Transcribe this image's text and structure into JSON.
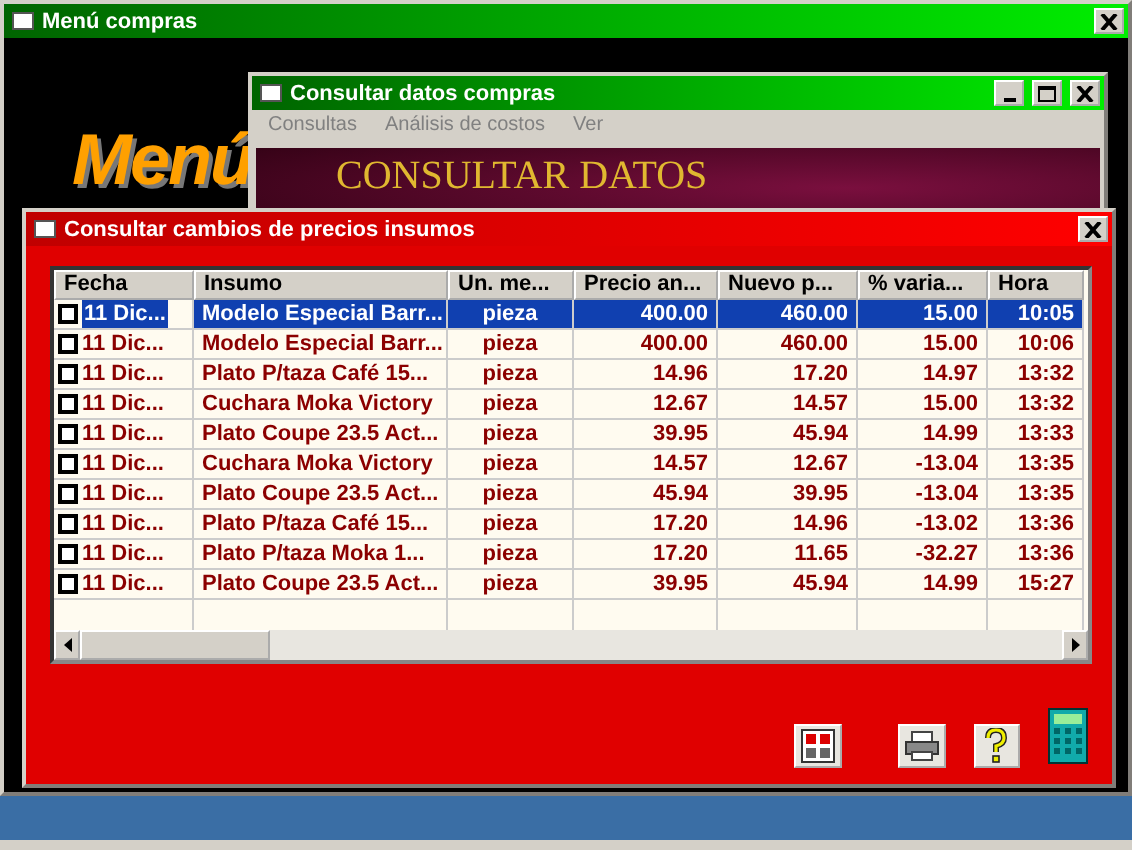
{
  "main_window": {
    "title": "Menú compras",
    "logo": "Menú"
  },
  "query_window": {
    "title": "Consultar datos compras",
    "menu": [
      "Consultas",
      "Análisis de costos",
      "Ver"
    ],
    "banner": "CONSULTAR DATOS"
  },
  "changes_window": {
    "title": "Consultar cambios de precios insumos",
    "table": {
      "columns": [
        "Fecha",
        "Insumo",
        "Un. me...",
        "Precio an...",
        "Nuevo p...",
        "% varia...",
        "Hora"
      ],
      "rows": [
        {
          "checked": false,
          "selected": true,
          "cells": [
            "11 Dic...",
            "Modelo Especial Barr...",
            "pieza",
            "400.00",
            "460.00",
            "15.00",
            "10:05"
          ]
        },
        {
          "checked": false,
          "selected": false,
          "cells": [
            "11 Dic...",
            "Modelo Especial Barr...",
            "pieza",
            "400.00",
            "460.00",
            "15.00",
            "10:06"
          ]
        },
        {
          "checked": false,
          "selected": false,
          "cells": [
            "11 Dic...",
            "Plato P/taza Café 15...",
            "pieza",
            "14.96",
            "17.20",
            "14.97",
            "13:32"
          ]
        },
        {
          "checked": false,
          "selected": false,
          "cells": [
            "11 Dic...",
            "Cuchara Moka Victory",
            "pieza",
            "12.67",
            "14.57",
            "15.00",
            "13:32"
          ]
        },
        {
          "checked": false,
          "selected": false,
          "cells": [
            "11 Dic...",
            "Plato Coupe 23.5 Act...",
            "pieza",
            "39.95",
            "45.94",
            "14.99",
            "13:33"
          ]
        },
        {
          "checked": false,
          "selected": false,
          "cells": [
            "11 Dic...",
            "Cuchara Moka Victory",
            "pieza",
            "14.57",
            "12.67",
            "-13.04",
            "13:35"
          ]
        },
        {
          "checked": false,
          "selected": false,
          "cells": [
            "11 Dic...",
            "Plato Coupe 23.5 Act...",
            "pieza",
            "45.94",
            "39.95",
            "-13.04",
            "13:35"
          ]
        },
        {
          "checked": false,
          "selected": false,
          "cells": [
            "11 Dic...",
            "Plato P/taza Café 15...",
            "pieza",
            "17.20",
            "14.96",
            "-13.02",
            "13:36"
          ]
        },
        {
          "checked": false,
          "selected": false,
          "cells": [
            "11 Dic...",
            "Plato P/taza Moka 1...",
            "pieza",
            "17.20",
            "11.65",
            "-32.27",
            "13:36"
          ]
        },
        {
          "checked": false,
          "selected": false,
          "cells": [
            "11 Dic...",
            "Plato Coupe 23.5 Act...",
            "pieza",
            "39.95",
            "45.94",
            "14.99",
            "15:27"
          ]
        }
      ]
    }
  }
}
